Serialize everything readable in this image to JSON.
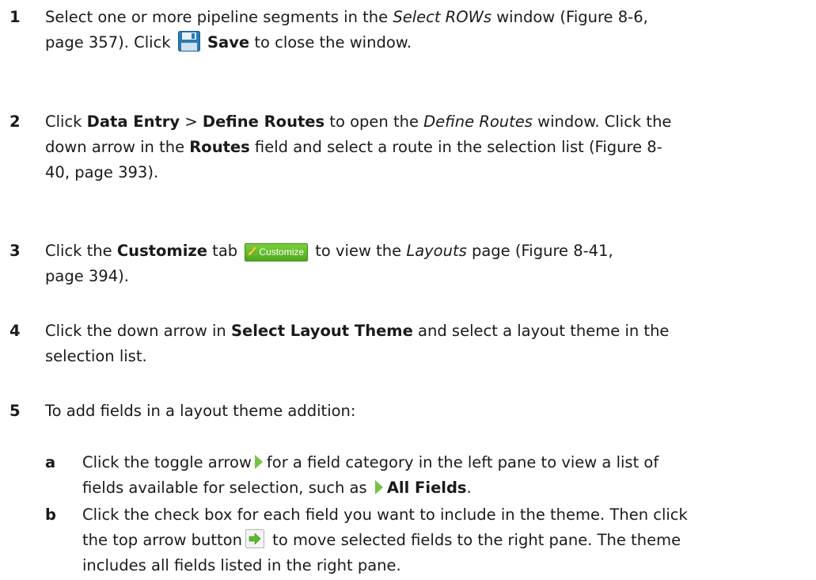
{
  "steps": [
    {
      "number": "1",
      "lines": {
        "l1_a": "Select one or more pipeline segments in the ",
        "l1_italic": "Select ROWs",
        "l1_b": " window (Figure 8-6,",
        "l2_a": "page 357). Click ",
        "l2_bold": "Save",
        "l2_b": " to close the window."
      }
    },
    {
      "number": "2",
      "lines": {
        "a": "Click ",
        "data_entry": "Data Entry",
        "gt": " > ",
        "define_routes": "Define Routes",
        "b": " to open the ",
        "define_routes_italic": "Define Routes",
        "c": " window. Click the",
        "d": "down arrow in the ",
        "routes": "Routes",
        "e": " field and select a route in the selection list (Figure 8-",
        "f": "40, page 393)."
      }
    },
    {
      "number": "3",
      "lines": {
        "a": "Click the ",
        "customize": "Customize",
        "b": " tab",
        "c": " to view the ",
        "layouts": "Layouts",
        "d": " page (Figure 8-41,",
        "e": "page 394)."
      }
    },
    {
      "number": "4",
      "lines": {
        "a": "Click the down arrow in ",
        "select_layout_theme": "Select Layout Theme",
        "b": " and select a layout theme in the",
        "c": "selection list."
      }
    },
    {
      "number": "5",
      "lines": {
        "a": "To add fields in a layout theme addition:"
      }
    }
  ],
  "substeps": [
    {
      "letter": "a",
      "lines": {
        "a": "Click the toggle arrow",
        "b": "for a field category in the left pane to view a list of",
        "c": "fields available for selection, such as ",
        "all_fields": "All Fields",
        "d": "."
      }
    },
    {
      "letter": "b",
      "lines": {
        "a": "Click the check box for each field you want to include in the theme. Then click",
        "b": "the top arrow button",
        "c": " to move selected fields to the right pane. The theme",
        "d": "includes all fields listed in the right pane."
      }
    }
  ],
  "icons": {
    "customize_tab_label": "Customize",
    "save_icon": "floppy-disk-icon",
    "toggle_icon": "green-triangle-right-icon",
    "arrow_button_icon": "green-arrow-right-icon",
    "accent_green": "#7ac143",
    "save_blue": "#2a7ab8"
  }
}
